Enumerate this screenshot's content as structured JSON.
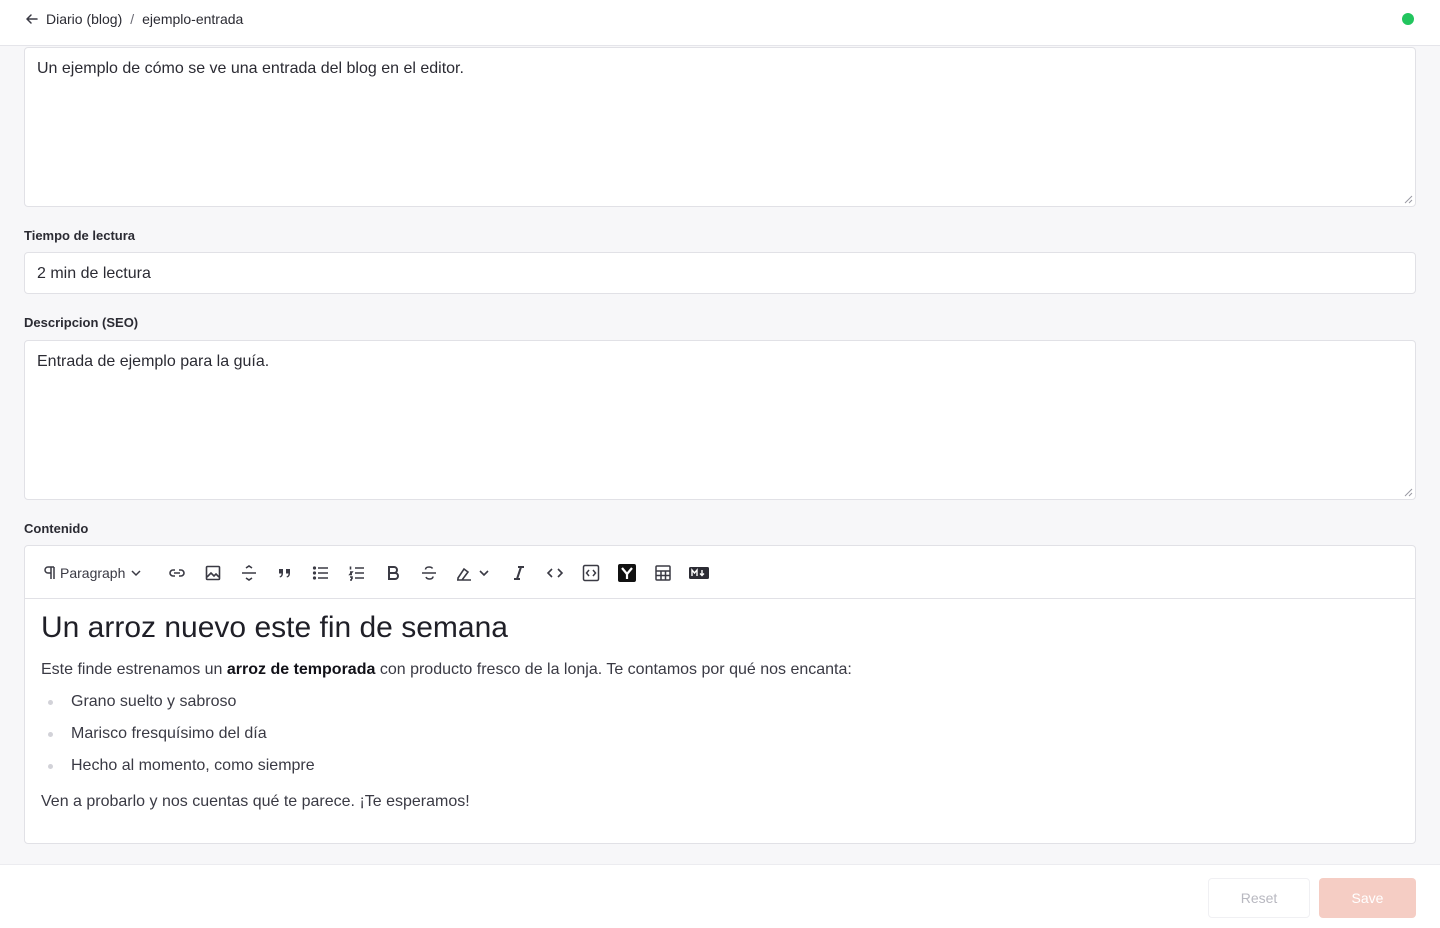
{
  "header": {
    "breadcrumb_parent": "Diario (blog)",
    "breadcrumb_separator": "/",
    "breadcrumb_current": "ejemplo-entrada",
    "status_color": "#22c55e"
  },
  "fields": {
    "summary_value": "Un ejemplo de cómo se ve una entrada del blog en el editor.",
    "reading_time_label": "Tiempo de lectura",
    "reading_time_value": "2 min de lectura",
    "seo_label": "Descripcion (SEO)",
    "seo_value": "Entrada de ejemplo para la guía.",
    "content_label": "Contenido"
  },
  "editor": {
    "toolbar": {
      "block_type": "Paragraph",
      "icons": [
        "paragraph-icon",
        "link-icon",
        "image-icon",
        "horizontal-rule-icon",
        "blockquote-icon",
        "bullet-list-icon",
        "ordered-list-icon",
        "bold-icon",
        "strikethrough-icon",
        "highlight-icon",
        "italic-icon",
        "inline-code-icon",
        "code-block-icon",
        "youtube-icon",
        "table-icon",
        "markdown-icon"
      ]
    },
    "heading": "Un arroz nuevo este fin de semana",
    "intro_before": "Este finde estrenamos un ",
    "intro_bold": "arroz de temporada",
    "intro_after": " con producto fresco de la lonja. Te contamos por qué nos encanta:",
    "list": [
      "Grano suelto y sabroso",
      "Marisco fresquísimo del día",
      "Hecho al momento, como siempre"
    ],
    "closing": "Ven a probarlo y nos cuentas qué te parece. ¡Te esperamos!"
  },
  "footer": {
    "reset_label": "Reset",
    "save_label": "Save",
    "save_color": "#f5cdc4"
  }
}
